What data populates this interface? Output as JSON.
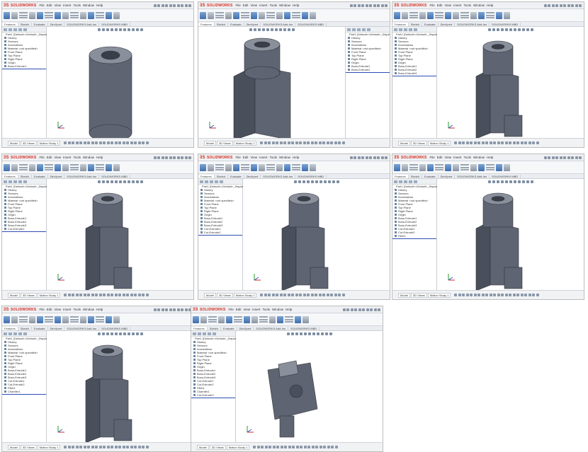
{
  "app": {
    "logo_text": "SOLIDWORKS",
    "logo_mark": "3S",
    "menus": [
      "File",
      "Edit",
      "View",
      "Insert",
      "Tools",
      "Window",
      "Help"
    ]
  },
  "cm_tabs": [
    "Features",
    "Sketch",
    "Evaluate",
    "DimXpert",
    "SOLIDWORKS Add-Ins",
    "SOLIDWORKS MBD"
  ],
  "bottom_tabs": [
    "Model",
    "3D Views",
    "Motion Study 1"
  ],
  "feature_tree_base": [
    "Part1 (Default<<Default>_Display State",
    "History",
    "Sensors",
    "Annotations",
    "Material <not specified>",
    "Front Plane",
    "Top Plane",
    "Right Plane",
    "Origin"
  ],
  "screenshots": [
    {
      "label": "step-1",
      "tree_extra": [
        "Boss-Extrude1"
      ],
      "model": "cylinder"
    },
    {
      "label": "step-2",
      "tree_extra": [
        "Boss-Extrude1",
        "Boss-Extrude2"
      ],
      "model": "block"
    },
    {
      "label": "step-3",
      "tree_extra": [
        "Boss-Extrude1",
        "Boss-Extrude2",
        "Boss-Extrude3"
      ],
      "model": "block-step"
    },
    {
      "label": "step-4",
      "tree_extra": [
        "Boss-Extrude1",
        "Boss-Extrude2",
        "Boss-Extrude3",
        "Cut-Extrude1"
      ],
      "model": "stack"
    },
    {
      "label": "step-5",
      "tree_extra": [
        "Boss-Extrude1",
        "Boss-Extrude2",
        "Boss-Extrude3",
        "Cut-Extrude1",
        "Cut-Extrude2"
      ],
      "model": "stack"
    },
    {
      "label": "step-6",
      "tree_extra": [
        "Boss-Extrude1",
        "Boss-Extrude2",
        "Boss-Extrude3",
        "Cut-Extrude1",
        "Cut-Extrude2",
        "Fillet1"
      ],
      "model": "stack"
    },
    {
      "label": "step-7",
      "tree_extra": [
        "Boss-Extrude1",
        "Boss-Extrude2",
        "Boss-Extrude3",
        "Cut-Extrude1",
        "Cut-Extrude2",
        "Fillet1",
        "Chamfer1"
      ],
      "model": "stack"
    },
    {
      "label": "step-8",
      "tree_extra": [
        "Boss-Extrude1",
        "Boss-Extrude2",
        "Boss-Extrude3",
        "Cut-Extrude1",
        "Cut-Extrude2",
        "Fillet1",
        "Chamfer1",
        "Cut-Extrude3"
      ],
      "model": "top"
    }
  ],
  "colors": {
    "part_front": "#5f6472",
    "part_side": "#4a4f5c",
    "part_top": "#8a8f9c",
    "rollback_bar": "#2c4fb4",
    "logo_red": "#d52b1e"
  }
}
